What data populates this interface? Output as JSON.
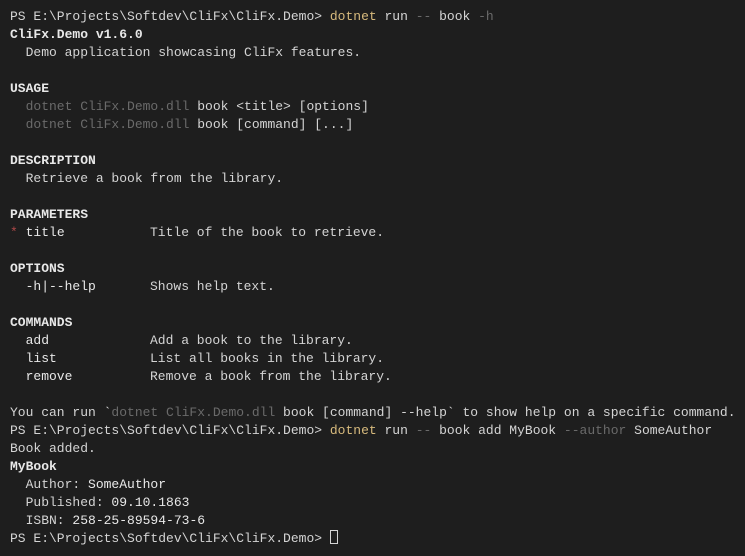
{
  "prompt": "PS E:\\Projects\\Softdev\\CliFx\\CliFx.Demo> ",
  "cmd1": {
    "exe": "dotnet",
    "run": " run ",
    "dash": "-- ",
    "sub": "book ",
    "flag": "-h"
  },
  "app_version": "CliFx.Demo v1.6.0",
  "app_desc": "  Demo application showcasing CliFx features.",
  "usage_header": "USAGE",
  "usage": {
    "prefix": "  dotnet CliFx.Demo.dll",
    "line1_rest": " book <title> [options]",
    "line2_rest": " book [command] [...]"
  },
  "description_header": "DESCRIPTION",
  "description_text": "  Retrieve a book from the library.",
  "parameters_header": "PARAMETERS",
  "param": {
    "star": "* ",
    "name": "title",
    "desc": "Title of the book to retrieve."
  },
  "options_header": "OPTIONS",
  "option": {
    "name": "  -h|--help",
    "desc": "Shows help text."
  },
  "commands_header": "COMMANDS",
  "commands": [
    {
      "name": "  add",
      "desc": "Add a book to the library."
    },
    {
      "name": "  list",
      "desc": "List all books in the library."
    },
    {
      "name": "  remove",
      "desc": "Remove a book from the library."
    }
  ],
  "hint": {
    "prefix": "You can run `",
    "dimexe": "dotnet CliFx.Demo.dll",
    "cmd": " book [command] --help",
    "suffix": "` to show help on a specific command."
  },
  "cmd2": {
    "exe": "dotnet",
    "run": " run ",
    "dash": "-- ",
    "rest": "book add MyBook ",
    "authorflag": "--author ",
    "author": "SomeAuthor"
  },
  "added": "Book added.",
  "detail": {
    "title": "MyBook",
    "author_label": "  Author: ",
    "author_value": "SomeAuthor",
    "published_label": "  Published: ",
    "published_value": "09.10.1863",
    "isbn_label": "  ISBN: ",
    "isbn_value": "258-25-89594-73-6"
  }
}
